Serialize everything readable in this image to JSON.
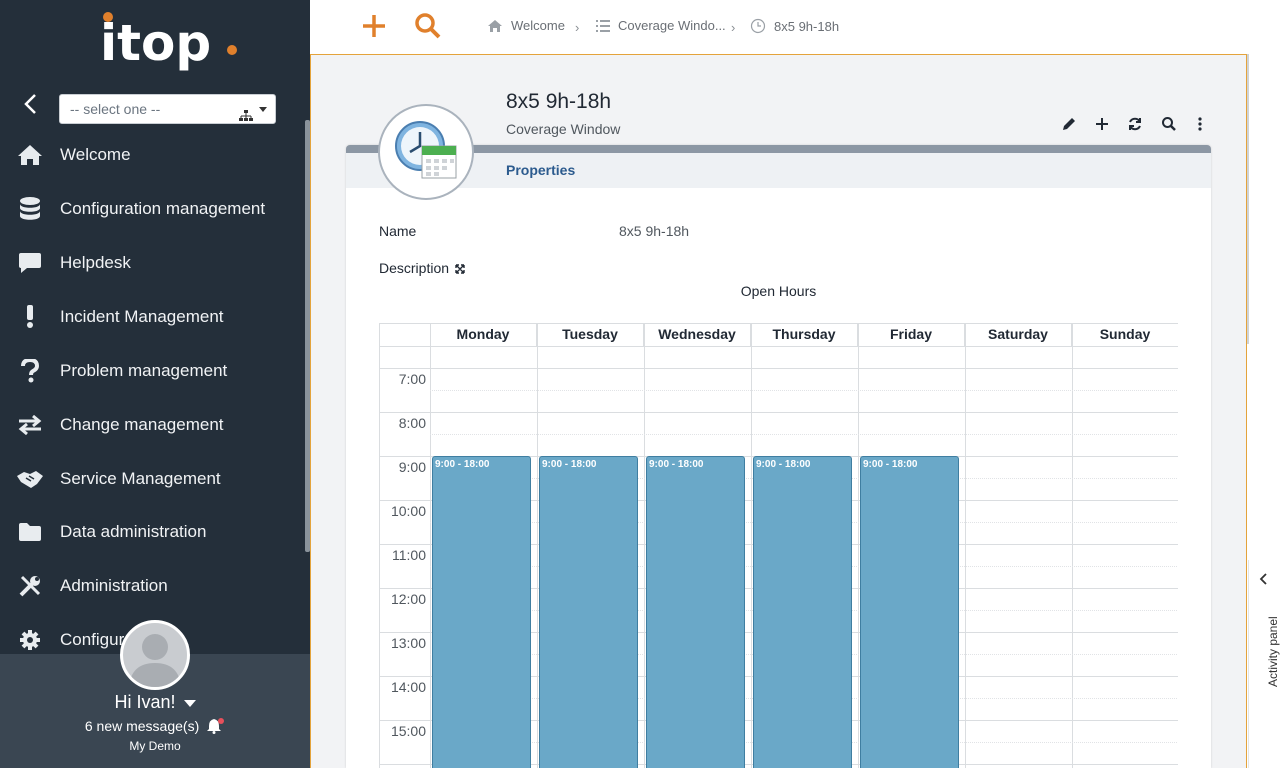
{
  "sidebar": {
    "logo_text": "itop",
    "org_select": {
      "placeholder": "-- select one --"
    },
    "menu": [
      {
        "label": "Welcome",
        "icon": "home-icon"
      },
      {
        "label": "Configuration management",
        "icon": "database-icon"
      },
      {
        "label": "Helpdesk",
        "icon": "chat-bubble-icon"
      },
      {
        "label": "Incident Management",
        "icon": "exclamation-icon"
      },
      {
        "label": "Problem management",
        "icon": "question-icon"
      },
      {
        "label": "Change management",
        "icon": "exchange-arrows-icon"
      },
      {
        "label": "Service Management",
        "icon": "handshake-icon"
      },
      {
        "label": "Data administration",
        "icon": "folder-icon"
      },
      {
        "label": "Administration",
        "icon": "tools-icon"
      },
      {
        "label": "Configur",
        "icon": "gear-icon"
      }
    ],
    "user": {
      "greeting": "Hi Ivan!",
      "messages": "6 new message(s)",
      "organization": "My Demo"
    }
  },
  "topbar": {
    "breadcrumbs": [
      {
        "label": "Welcome",
        "icon": "home-icon"
      },
      {
        "label": "Coverage Windo...",
        "icon": "list-icon"
      },
      {
        "label": "8x5 9h-18h",
        "icon": "clock-icon"
      }
    ]
  },
  "object": {
    "title": "8x5 9h-18h",
    "class": "Coverage Window",
    "tab": "Properties",
    "name_label": "Name",
    "name_value": "8x5 9h-18h",
    "description_label": "Description"
  },
  "calendar": {
    "caption": "Open Hours",
    "days": [
      "Monday",
      "Tuesday",
      "Wednesday",
      "Thursday",
      "Friday",
      "Saturday",
      "Sunday"
    ],
    "times": [
      "7:00",
      "8:00",
      "9:00",
      "10:00",
      "11:00",
      "12:00",
      "13:00",
      "14:00",
      "15:00"
    ],
    "event_label": "9:00 - 18:00"
  },
  "activity_panel": {
    "label": "Activity panel"
  },
  "colors": {
    "sidebar_bg": "#242f3a",
    "accent_orange": "#e0802c",
    "event_fill": "#6aa8c8",
    "tab_text": "#2c5b8e"
  }
}
